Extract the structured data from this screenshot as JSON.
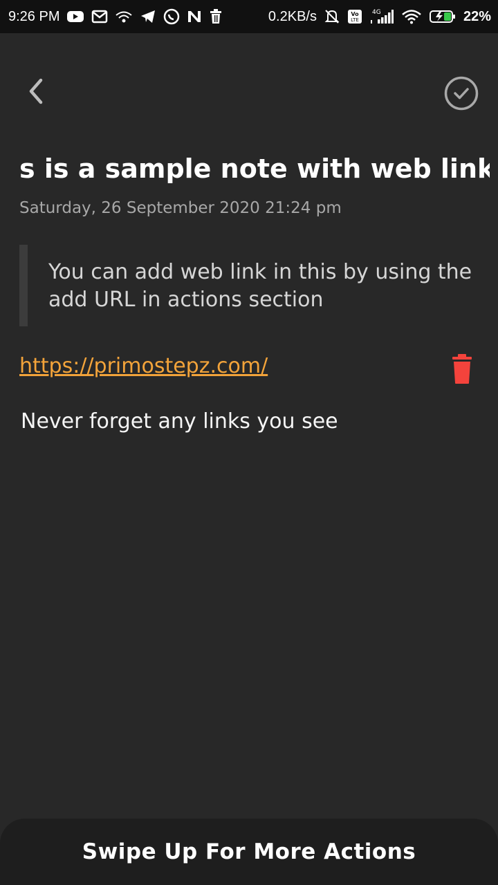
{
  "status_bar": {
    "time": "9:26 PM",
    "network_speed": "0.2KB/s",
    "network_type": "4G",
    "volte": "Vo LTE",
    "battery_percent": "22%",
    "icons": [
      "youtube-icon",
      "gmail-icon",
      "wifi-hotspot-icon",
      "telegram-icon",
      "whatsapp-icon",
      "n-app-icon",
      "trash-notify-icon",
      "mute-alarm-icon",
      "volte-icon",
      "signal-icon",
      "wifi-icon",
      "battery-charging-icon"
    ]
  },
  "toolbar": {
    "back_icon": "chevron-left-icon",
    "done_icon": "check-circle-icon"
  },
  "note": {
    "title": "s is a sample note with web link",
    "date": "Saturday, 26 September 2020 21:24 pm",
    "quote": "You can add web link in this by using the add URL in actions section",
    "link": "https://primostepz.com/",
    "body": "Never forget any links you see"
  },
  "bottom_sheet": {
    "label": "Swipe Up For More Actions"
  },
  "colors": {
    "background": "#282828",
    "status_bar": "#111111",
    "link": "#f2a33a",
    "delete": "#f4433c",
    "quote_bar": "#3c3c3c"
  }
}
